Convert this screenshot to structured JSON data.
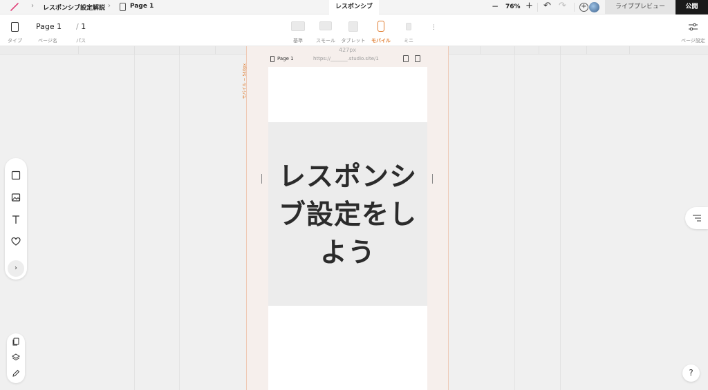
{
  "topbar": {
    "project_name": "レスポンシブ設定解説",
    "page_name": "Page 1",
    "active_tab": "レスポンシブ",
    "zoom_minus": "−",
    "zoom": "76%",
    "zoom_plus": "+",
    "undo": "↶",
    "redo": "↷",
    "add_user": "+",
    "live_preview": "ライブプレビュー",
    "publish": "公開",
    "breadcrumb_sep": "›"
  },
  "toolbar": {
    "type_label": "タイプ",
    "page_name_value": "Page 1",
    "page_name_label": "ページ名",
    "path_slash": "/",
    "path_value": "1",
    "path_label": "パス",
    "devices": [
      {
        "label": "基準"
      },
      {
        "label": "スモール"
      },
      {
        "label": "タブレット"
      },
      {
        "label": "モバイル"
      },
      {
        "label": "ミニ"
      }
    ],
    "active_device": "モバイル",
    "page_settings_label": "ページ設定",
    "kebab": "⋮"
  },
  "canvas": {
    "width_label": "427px",
    "device_vertical_label": "モバイル ~ 540px",
    "page_label": "Page 1",
    "url": "https://_______.studio.site/1",
    "hero_text": "レスポンシブ設定をしよう"
  },
  "tools": {
    "expand": "›",
    "help": "?"
  },
  "colors": {
    "accent": "#e07b2e",
    "publish_bg": "#1a1a1a",
    "hero_bg": "#ececec",
    "frame_bg": "#f6efec"
  }
}
